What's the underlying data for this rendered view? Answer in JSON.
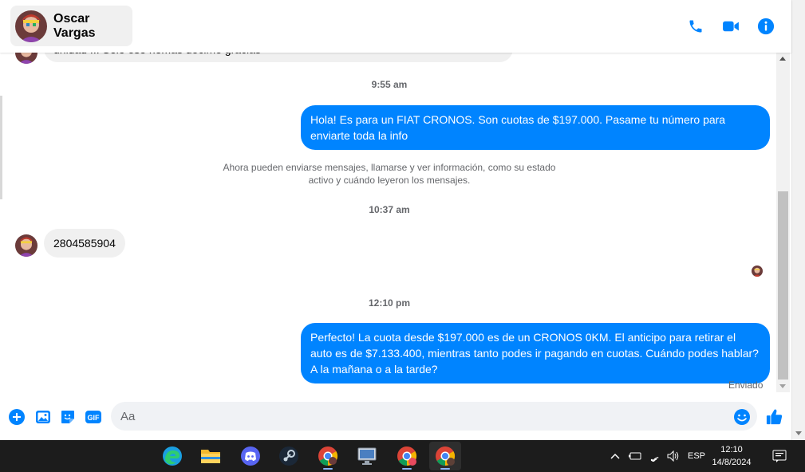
{
  "header": {
    "contact_name": "Oscar Vargas",
    "icons": [
      "phone-icon",
      "video-camera-icon",
      "info-icon"
    ],
    "accent": "#0084ff"
  },
  "thread": {
    "partial_top_text": "unidad !!! Solo eso nomas decime gracias",
    "time_1": "9:55 am",
    "out_1": "Hola! Es para un FIAT CRONOS. Son cuotas de $197.000. Pasame tu número para enviarte toda la info",
    "system_notice": "Ahora pueden enviarse mensajes, llamarse y ver información, como su estado activo y cuándo leyeron los mensajes.",
    "time_2": "10:37 am",
    "in_1": "2804585904",
    "time_3": "12:10 pm",
    "out_2": "Perfecto! La cuota desde $197.000 es de un CRONOS 0KM. El anticipo para retirar el auto es de $7.133.400, mientras tanto podes ir pagando en cuotas. Cuándo podes hablar? A la mañana o a la tarde?",
    "status": "Enviado"
  },
  "composer": {
    "placeholder": "Aa",
    "icons": [
      "plus-icon",
      "image-icon",
      "sticker-icon",
      "gif-icon",
      "emoji-icon",
      "thumbs-up-icon"
    ],
    "gif_label": "GIF"
  },
  "taskbar": {
    "apps": [
      "edge-icon",
      "file-explorer-icon",
      "discord-icon",
      "steam-icon",
      "chrome-icon",
      "monitor-app-icon",
      "chrome-profile-icon",
      "chrome-profile-c-icon"
    ],
    "language": "ESP",
    "time": "12:10",
    "date": "14/8/2024"
  }
}
